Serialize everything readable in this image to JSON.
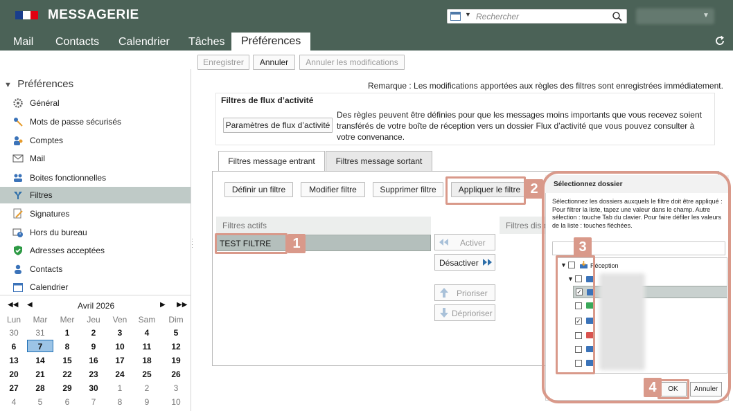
{
  "app": {
    "title": "MESSAGERIE"
  },
  "search": {
    "placeholder": "Rechercher"
  },
  "nav": {
    "tabs": [
      {
        "label": "Mail"
      },
      {
        "label": "Contacts"
      },
      {
        "label": "Calendrier"
      },
      {
        "label": "Tâches"
      },
      {
        "label": "Préférences"
      }
    ],
    "active": "Préférences"
  },
  "toolbar": {
    "save": "Enregistrer",
    "cancel": "Annuler",
    "cancel_changes": "Annuler les modifications"
  },
  "sidebar": {
    "title": "Préférences",
    "items": [
      {
        "label": "Général",
        "icon": "gear-icon"
      },
      {
        "label": "Mots de passe sécurisés",
        "icon": "key-icon"
      },
      {
        "label": "Comptes",
        "icon": "accounts-icon"
      },
      {
        "label": "Mail",
        "icon": "mail-icon"
      },
      {
        "label": "Boites fonctionnelles",
        "icon": "shared-box-icon"
      },
      {
        "label": "Filtres",
        "icon": "filter-icon"
      },
      {
        "label": "Signatures",
        "icon": "signature-icon"
      },
      {
        "label": "Hors du bureau",
        "icon": "out-of-office-icon"
      },
      {
        "label": "Adresses acceptées",
        "icon": "shield-check-icon"
      },
      {
        "label": "Contacts",
        "icon": "contact-icon"
      },
      {
        "label": "Calendrier",
        "icon": "calendar-icon"
      }
    ],
    "selected": "Filtres"
  },
  "calendar": {
    "month": "Avril 2026",
    "days_of_week": [
      "Lun",
      "Mar",
      "Mer",
      "Jeu",
      "Ven",
      "Sam",
      "Dim"
    ],
    "weeks": [
      [
        "30",
        "31",
        "1",
        "2",
        "3",
        "4",
        "5"
      ],
      [
        "6",
        "7",
        "8",
        "9",
        "10",
        "11",
        "12"
      ],
      [
        "13",
        "14",
        "15",
        "16",
        "17",
        "18",
        "19"
      ],
      [
        "20",
        "21",
        "22",
        "23",
        "24",
        "25",
        "26"
      ],
      [
        "27",
        "28",
        "29",
        "30",
        "1",
        "2",
        "3"
      ],
      [
        "4",
        "5",
        "6",
        "7",
        "8",
        "9",
        "10"
      ]
    ],
    "today": "7"
  },
  "main": {
    "remark": "Remarque : Les modifications apportées aux règles des filtres sont enregistrées immédiatement.",
    "flux_title": "Filtres de flux d’activité",
    "flux_button": "Paramètres de flux d’activité",
    "flux_desc": "Des règles peuvent être définies pour que les messages moins importants que vous recevez soient transférés de votre boîte de réception vers un dossier Flux d’activité que vous pouvez consulter à votre convenance.",
    "tabs": [
      {
        "label": "Filtres message entrant"
      },
      {
        "label": "Filtres message sortant"
      }
    ],
    "actions": {
      "define": "Définir un filtre",
      "modify": "Modifier filtre",
      "delete": "Supprimer filtre",
      "apply": "Appliquer le filtre"
    },
    "active_filters_header": "Filtres actifs",
    "active_filters": [
      "TEST FILTRE"
    ],
    "available_header": "Filtres disponibles",
    "move_buttons": {
      "activate": "Activer",
      "deactivate": "Désactiver",
      "prioritize": "Prioriser",
      "deprioritize": "Déprioriser"
    }
  },
  "dialog": {
    "title": "Sélectionnez dossier",
    "desc": "Sélectionnez les dossiers auxquels le filtre doit être appliqué :\nPour filtrer la liste, tapez une valeur dans le champ. Autre sélection : touche Tab du clavier. Pour faire défiler les valeurs de la liste : touches fléchées.",
    "root_label": "Réception",
    "ok": "OK",
    "cancel": "Annuler"
  },
  "markers": [
    "1",
    "2",
    "3",
    "4"
  ],
  "colors": {
    "header_bg": "#4b6257",
    "highlight": "#d9998a",
    "selected_bg": "#bfcac7"
  }
}
